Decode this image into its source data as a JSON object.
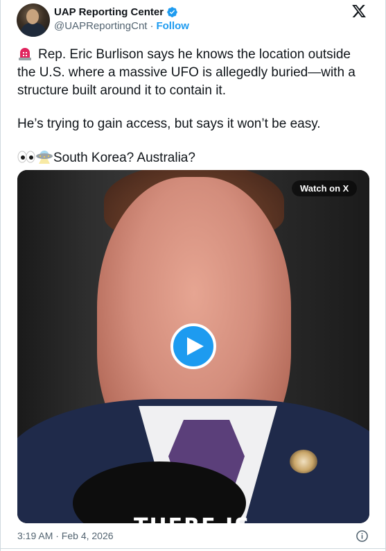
{
  "author": {
    "display_name": "UAP Reporting Center",
    "handle": "@UAPReportingCnt",
    "separator": "·",
    "follow_label": "Follow"
  },
  "tweet": {
    "paragraph1": "Rep. Eric Burlison says he knows the location outside the U.S. where a massive UFO is allegedly buried—with a structure built around it to contain it.",
    "paragraph2": "He’s trying to gain access, but says it won’t be easy.",
    "paragraph3": "South Korea? Australia?"
  },
  "media": {
    "watch_label": "Watch on X",
    "caption_peek": "THERE IS"
  },
  "footer": {
    "timestamp": "3:19 AM · Feb 4, 2026"
  },
  "icons": {
    "verified": "verified-badge-icon",
    "x_logo": "x-logo-icon",
    "play": "play-icon",
    "info": "info-icon",
    "siren": "siren-emoji-icon",
    "eyes": "eyes-emoji-icon",
    "ufo": "flying-saucer-emoji-icon"
  },
  "colors": {
    "accent": "#1d9bf0",
    "text": "#0f1419",
    "muted": "#536471",
    "border": "#cfd9de"
  }
}
